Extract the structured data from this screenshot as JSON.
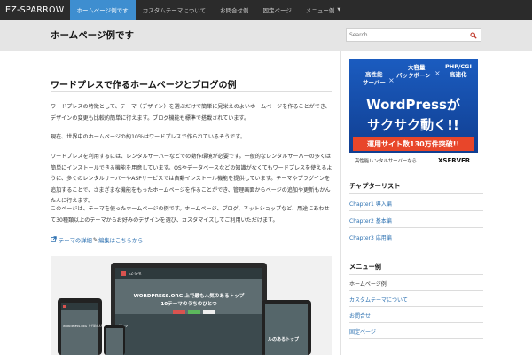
{
  "navbar": {
    "brand": "EZ-SPARROW",
    "items": [
      {
        "label": "ホームページ例です"
      },
      {
        "label": "カスタムテーマについて"
      },
      {
        "label": "お問合せ例"
      },
      {
        "label": "固定ページ"
      },
      {
        "label": "メニュー例"
      }
    ]
  },
  "header": {
    "site_title": "ホームページ例です",
    "search_placeholder": "Search"
  },
  "post": {
    "title": "ワードプレスで作るホームページとブログの例",
    "paragraphs": [
      "ワードプレスの特徴として、テーマ（デザイン）を選ぶだけで簡単に見栄えのよいホームページを作ることができ、デザインの変更も比較的簡単に行えます。ブログ機能も標準で搭載されています。",
      "現在、世界中のホームページの約10％はワードプレスで作られているそうです。",
      "ワードプレスを利用するには、レンタルサーバーなどでの動作環境が必要です。一般的なレンタルサーバーの多くは簡単にインストールできる機能を用意しています。OSやデータベースなどの知識がなくてもワードプレスを使えるように、多くのレンタルサーバーやASPサービスでは自動インストール機能を提供しています。テーマやプラグインを追加することで、さまざまな機能をもったホームページを作ることができ、管理画面からページの追加や更新もかんたんに行えます。",
      "このページは、テーマを使ったホームページの例です。ホームページ、ブログ、ネットショップなど、用途にあわせて30種類以上のテーマからお好みのデザインを選び、カスタマイズしてご利用いただけます。"
    ],
    "link1": "テーマの詳細",
    "link2": "編集はこちらから"
  },
  "mockup": {
    "brand": "EZ-SPR",
    "headline": "WORDPRESS.ORG 上で最も人気のあるトップ",
    "subline": "10テーマのうちのひとつ",
    "tablet_text": "ルのあるトップ",
    "phone_text": "WORDPRESS.ORG 上で最も人気のあるトップテーマ"
  },
  "ad": {
    "line1": "高性能",
    "line1b": "サーバー",
    "line2": "大容量",
    "line2b": "バックボーン",
    "line3": "PHP/CGI",
    "line3b": "高速化",
    "main1": "WordPressが",
    "main2": "サクサク動く!!",
    "banner": "運用サイト数130万件突破!!",
    "footer": "高性能レンタルサーバーなら",
    "logo": "XSERVER"
  },
  "sidebar": {
    "widget1_title": "チャプターリスト",
    "widget1_items": [
      "Chapter1 導入編",
      "Chapter2 基本編",
      "Chapter3 応用編"
    ],
    "widget2_title": "メニュー例",
    "widget2_items": [
      "ホームページ例",
      "カスタムテーマについて",
      "お問合せ",
      "固定ページ"
    ]
  },
  "colors": {
    "navbar_bg": "#2b2b2b",
    "active_tab": "#3e8ed0",
    "link": "#2a6fb0",
    "ad_bg": "#1a4fa0",
    "ad_banner": "#e8462a"
  }
}
